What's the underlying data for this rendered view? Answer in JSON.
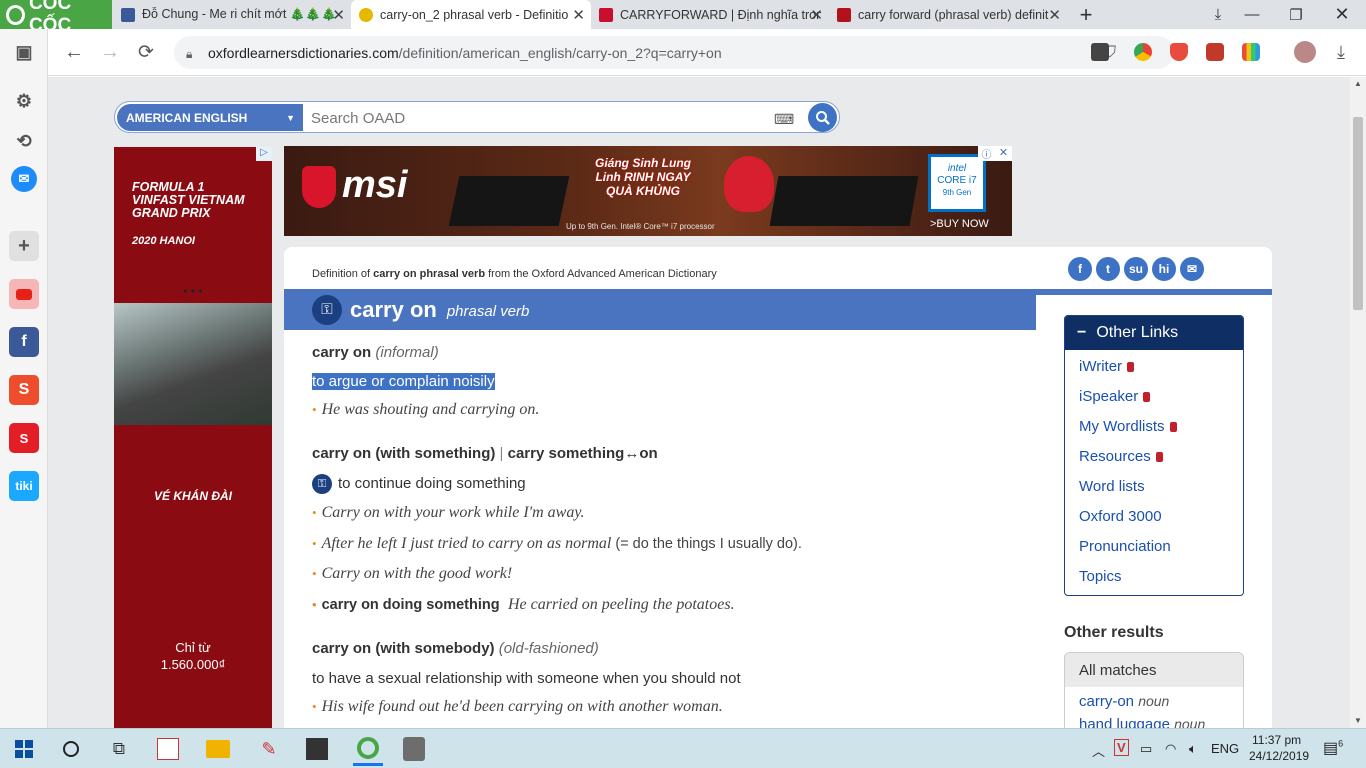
{
  "browser": {
    "brand": "CỐC CỐC",
    "tabs": [
      {
        "title": "Đỗ Chung - Me ri chít mớt 🎄🎄🎄",
        "favicon_color": "#3b5998"
      },
      {
        "title": "carry-on_2 phrasal verb - Definitio",
        "favicon_color": "#e6b800",
        "active": true
      },
      {
        "title": "CARRYFORWARD | Định nghĩa tron",
        "favicon_color": "#c8102e"
      },
      {
        "title": "carry forward (phrasal verb) definit",
        "favicon_color": "#b3121a"
      }
    ],
    "url_host": "oxfordlearnersdictionaries.com",
    "url_path": "/definition/american_english/carry-on_2?q=carry+on"
  },
  "search": {
    "dialect": "AMERICAN ENGLISH",
    "placeholder": "Search OAAD"
  },
  "left_ad": {
    "title": "FORMULA 1 VINFAST VIETNAM GRAND PRIX",
    "sub": "2020 HANOI",
    "dots": "• • •",
    "tagline": "VÉ KHÁN ĐÀI",
    "price_label": "Chỉ từ",
    "price": "1.560.000₫"
  },
  "top_ad": {
    "brand": "msi",
    "promo": "Giáng Sinh Lung Linh RINH NGAY QUÀ KHỦNG",
    "caption": "Up to 9th Gen. Intel® Core™ i7 processor",
    "badge_line1": "intel",
    "badge_line2": "CORE i7",
    "badge_line3": "9th Gen",
    "cta": ">BUY NOW"
  },
  "entry": {
    "definition_prefix": "Definition of",
    "definition_term": "carry on phrasal verb",
    "definition_suffix": "from the Oxford Advanced American Dictionary",
    "headword": "carry on",
    "pos": "phrasal verb",
    "senses": [
      {
        "head": "carry on",
        "label": "(informal)",
        "def": "to argue or complain noisily",
        "examples": [
          "He was shouting and carrying on."
        ]
      },
      {
        "head": "carry on (with something)",
        "sep": "|",
        "head2": "carry something↔on",
        "def": "to continue doing something",
        "examples": [
          "Carry on with your work while I'm away.",
          "After he left I just tried to carry on as normal",
          "Carry on with the good work!"
        ],
        "gloss": "(= do the things I usually do).",
        "pattern": "carry on doing something",
        "pattern_example": "He carried on peeling the potatoes."
      },
      {
        "head": "carry on (with somebody)",
        "label": "(old-fashioned)",
        "def": "to have a sexual relationship with someone when you should not",
        "examples": [
          "His wife found out he'd been carrying on with another woman."
        ]
      }
    ]
  },
  "sidebar_right": {
    "other_links_title": "Other Links",
    "other_links": [
      "iWriter",
      "iSpeaker",
      "My Wordlists",
      "Resources",
      "Word lists",
      "Oxford 3000",
      "Pronunciation",
      "Topics"
    ],
    "other_results_title": "Other results",
    "all_matches": "All matches",
    "results": [
      {
        "word": "carry-on",
        "pos": "noun"
      },
      {
        "word": "hand luggage",
        "pos": "noun"
      }
    ]
  },
  "taskbar": {
    "lang": "ENG",
    "time": "11:37 pm",
    "date": "24/12/2019",
    "notif_count": "6"
  }
}
